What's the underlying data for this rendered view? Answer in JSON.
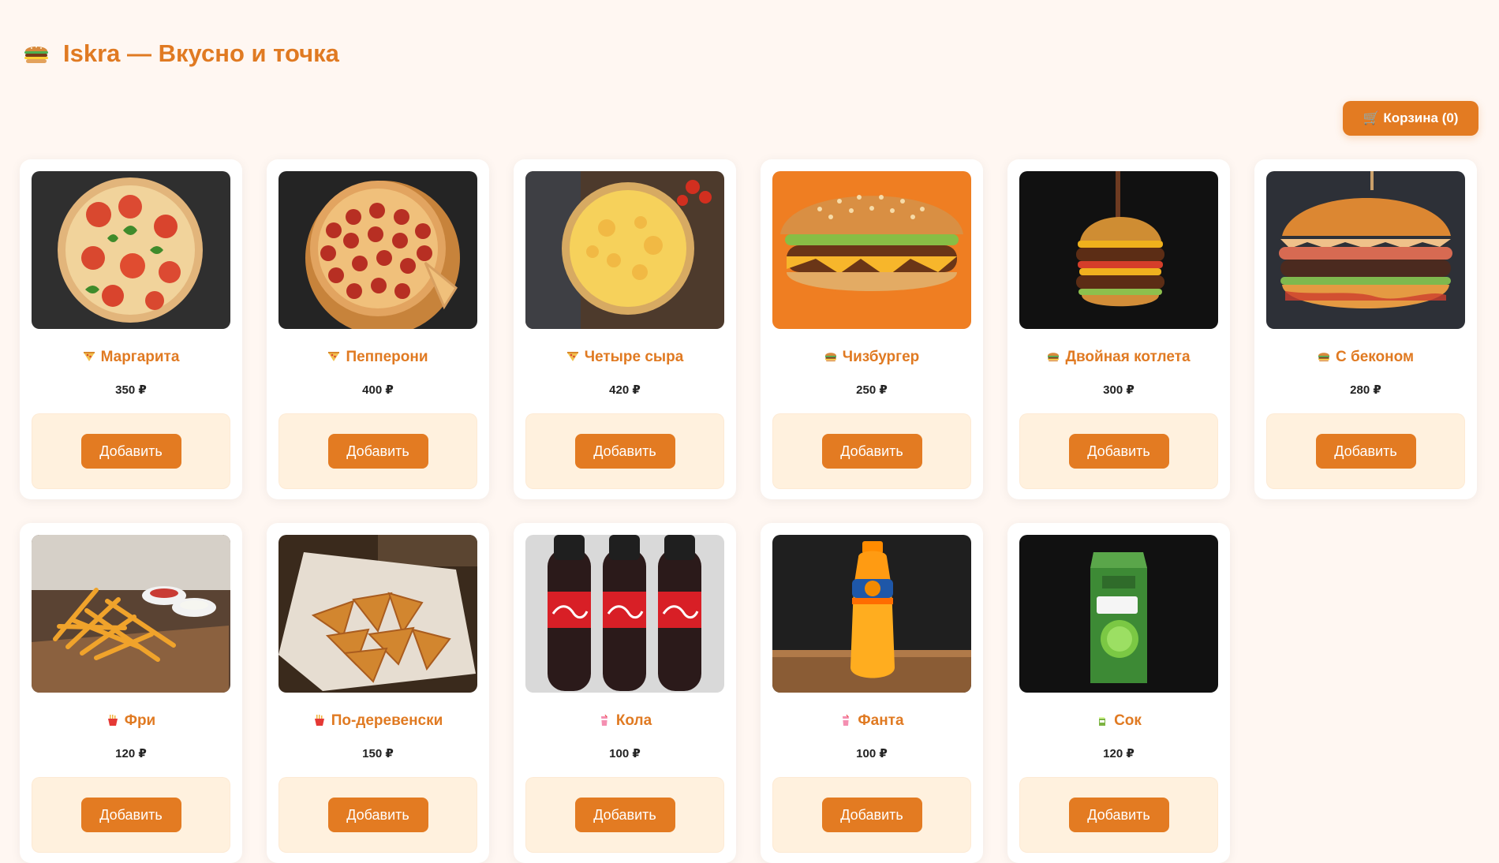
{
  "app": {
    "title": "Iskra — Вкусно и точка",
    "brand_icon": "burger-icon",
    "cart_label": "🛒 Корзина (0)",
    "accent_color": "#e07a22",
    "background_color": "#fff7f2"
  },
  "menu": {
    "items": [
      {
        "name": "Маргарита",
        "price": "350 ₽",
        "icon": "pizza-icon",
        "add_label": "Добавить",
        "image_type": "pizza-margherita"
      },
      {
        "name": "Пепперони",
        "price": "400 ₽",
        "icon": "pizza-icon",
        "add_label": "Добавить",
        "image_type": "pizza-pepperoni"
      },
      {
        "name": "Четыре сыра",
        "price": "420 ₽",
        "icon": "pizza-icon",
        "add_label": "Добавить",
        "image_type": "pizza-four-cheese"
      },
      {
        "name": "Чизбургер",
        "price": "250 ₽",
        "icon": "burger-icon",
        "add_label": "Добавить",
        "image_type": "cheeseburger"
      },
      {
        "name": "Двойная котлета",
        "price": "300 ₽",
        "icon": "burger-icon",
        "add_label": "Добавить",
        "image_type": "double-burger"
      },
      {
        "name": "С беконом",
        "price": "280 ₽",
        "icon": "burger-icon",
        "add_label": "Добавить",
        "image_type": "bacon-burger"
      },
      {
        "name": "Фри",
        "price": "120 ₽",
        "icon": "fries-icon",
        "add_label": "Добавить",
        "image_type": "fries"
      },
      {
        "name": "По-деревенски",
        "price": "150 ₽",
        "icon": "fries-icon",
        "add_label": "Добавить",
        "image_type": "wedges"
      },
      {
        "name": "Кола",
        "price": "100 ₽",
        "icon": "drink-icon",
        "add_label": "Добавить",
        "image_type": "cola"
      },
      {
        "name": "Фанта",
        "price": "100 ₽",
        "icon": "drink-icon",
        "add_label": "Добавить",
        "image_type": "fanta"
      },
      {
        "name": "Сок",
        "price": "120 ₽",
        "icon": "juice-icon",
        "add_label": "Добавить",
        "image_type": "juice"
      }
    ]
  }
}
